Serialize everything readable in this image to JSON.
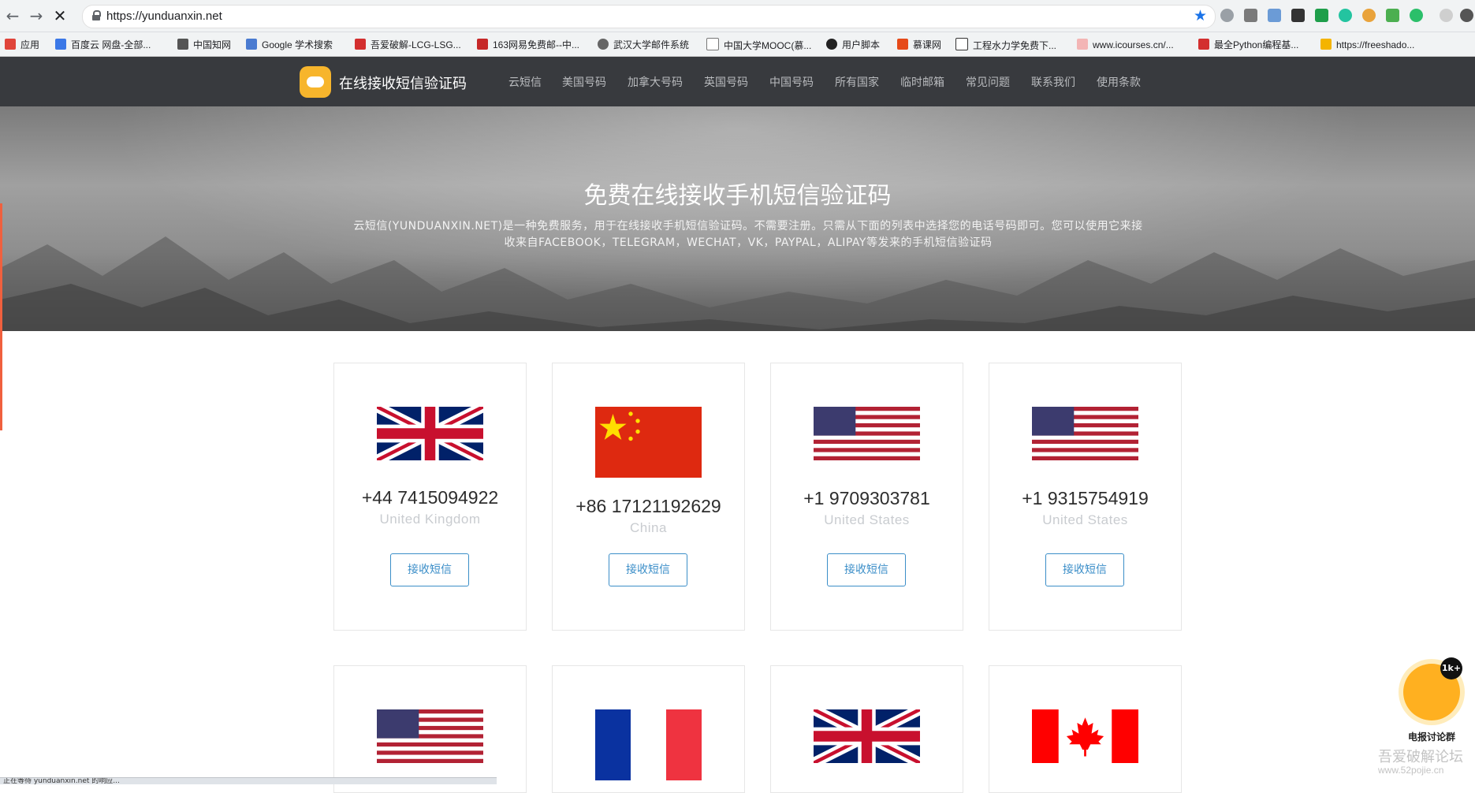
{
  "browser": {
    "url": "https://yunduanxin.net",
    "bookmarks": [
      "应用",
      "百度云 网盘-全部...",
      "中国知网",
      "Google 学术搜索",
      "吾爱破解-LCG-LSG...",
      "163网易免费邮--中...",
      "武汉大学邮件系统",
      "中国大学MOOC(慕...",
      "用户脚本",
      "慕课网",
      "工程水力学免费下...",
      "www.icourses.cn/...",
      "最全Python编程基...",
      "https://freeshado..."
    ],
    "status_text": "正在等待 yunduanxin.net 的响应..."
  },
  "site": {
    "brand": "在线接收短信验证码",
    "nav": [
      "云短信",
      "美国号码",
      "加拿大号码",
      "英国号码",
      "中国号码",
      "所有国家",
      "临时邮箱",
      "常见问题",
      "联系我们",
      "使用条款"
    ]
  },
  "hero": {
    "title": "免费在线接收手机短信验证码",
    "desc_line1": "云短信(YUNDUANXIN.NET)是一种免费服务，用于在线接收手机短信验证码。不需要注册。只需从下面的列表中选择您的电话号码即可。您可以使用它来接",
    "desc_line2": "收来自FACEBOOK，TELEGRAM，WECHAT，VK，PAYPAL，ALIPAY等发来的手机短信验证码"
  },
  "cards": [
    {
      "number": "+44 7415094922",
      "country": "United Kingdom",
      "flag": "uk",
      "button": "接收短信"
    },
    {
      "number": "+86 17121192629",
      "country": "China",
      "flag": "cn",
      "button": "接收短信"
    },
    {
      "number": "+1 9709303781",
      "country": "United States",
      "flag": "us",
      "button": "接收短信"
    },
    {
      "number": "+1 9315754919",
      "country": "United States",
      "flag": "us",
      "button": "接收短信"
    }
  ],
  "cards_row2_flags": [
    "us",
    "fr",
    "uk",
    "ca"
  ],
  "float": {
    "badge": "1k+",
    "label": "电报讨论群"
  },
  "watermark": {
    "line1": "吾爱破解论坛",
    "line2": "www.52pojie.cn"
  },
  "colors": {
    "header_bg": "#383a3e",
    "logo": "#f7b52c",
    "button": "#3b8ec8",
    "accent_line": "#f0603e"
  }
}
